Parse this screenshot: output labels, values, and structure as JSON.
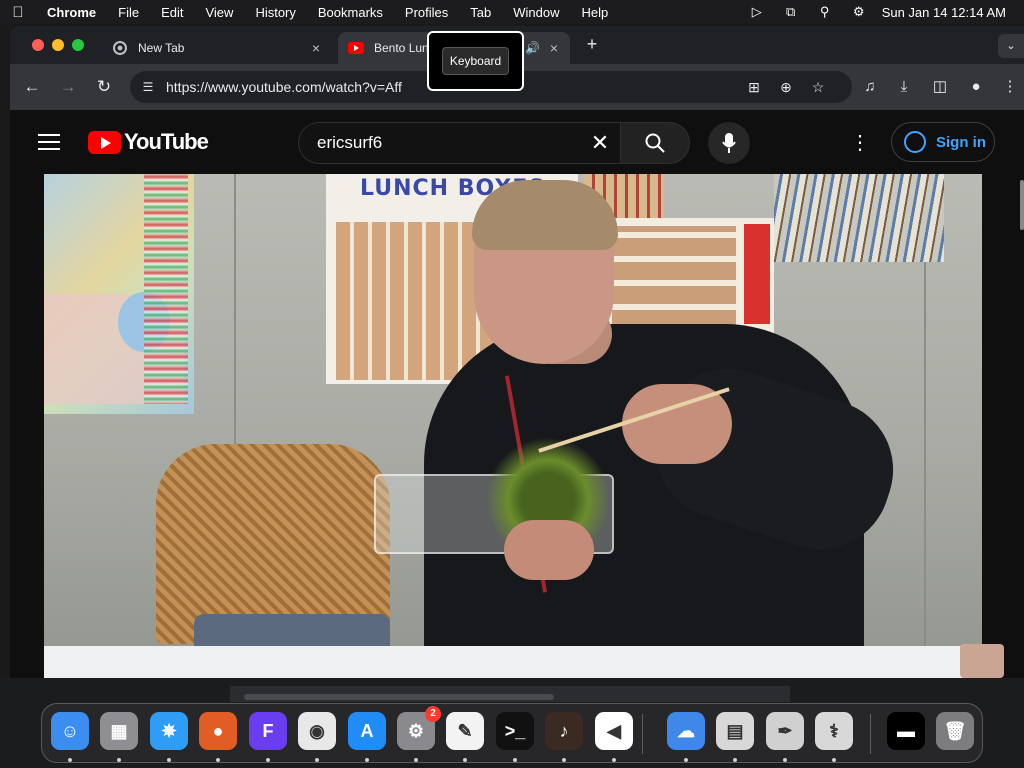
{
  "menubar": {
    "app_name": "Chrome",
    "items": [
      "File",
      "Edit",
      "View",
      "History",
      "Bookmarks",
      "Profiles",
      "Tab",
      "Window",
      "Help"
    ],
    "clock": "Sun Jan 14  12:14 AM"
  },
  "browser": {
    "tabs": [
      {
        "title": "New Tab",
        "close": "×"
      },
      {
        "title": "Bento Lunch",
        "close": "×"
      }
    ],
    "new_tab_symbol": "+",
    "tab_search_symbol": "⌄",
    "url": "https://www.youtube.com/watch?v=Aff",
    "tooltip": "Keyboard"
  },
  "youtube": {
    "logo_text": "YouTube",
    "search_query": "ericsurf6",
    "search_clear": "✕",
    "search_icon": "⌕",
    "mic_icon": "🎙",
    "more_icon": "⋮",
    "sign_in": "Sign in"
  },
  "video": {
    "poster_text": "LUNCH BOXES"
  },
  "dock": {
    "apps": [
      {
        "name": "Finder",
        "icon": "finder-icon",
        "color": "#3b8ef0",
        "glyph": "☺"
      },
      {
        "name": "Launchpad",
        "icon": "launchpad-icon",
        "color": "#8e8e93",
        "glyph": "▦"
      },
      {
        "name": "Safari",
        "icon": "safari-icon",
        "color": "#2f9cf5",
        "glyph": "✵"
      },
      {
        "name": "Firefox",
        "icon": "firefox-icon",
        "color": "#e25c25",
        "glyph": "●"
      },
      {
        "name": "Fleet",
        "icon": "fleet-icon",
        "color": "#6a3df0",
        "glyph": "F"
      },
      {
        "name": "Chrome",
        "icon": "chrome-icon",
        "color": "#e8e8e8",
        "glyph": "◉"
      },
      {
        "name": "App Store",
        "icon": "appstore-icon",
        "color": "#1f8cf8",
        "glyph": "A"
      },
      {
        "name": "System Settings",
        "icon": "settings-icon",
        "color": "#8a8a8e",
        "glyph": "⚙",
        "badge": "2"
      },
      {
        "name": "TextEdit",
        "icon": "textedit-icon",
        "color": "#f3f3f3",
        "glyph": "✎"
      },
      {
        "name": "Terminal",
        "icon": "terminal-icon",
        "color": "#111111",
        "glyph": ">_"
      },
      {
        "name": "GarageBand",
        "icon": "garageband-icon",
        "color": "#3b2a22",
        "glyph": "♪"
      },
      {
        "name": "Visual Studio Code",
        "icon": "vscode-icon",
        "color": "#ffffff",
        "glyph": "◀"
      },
      {
        "name": "Weather",
        "icon": "weather-icon",
        "color": "#3f87e8",
        "glyph": "☁"
      },
      {
        "name": "Preview",
        "icon": "preview-icon",
        "color": "#d8d8d8",
        "glyph": "▤"
      },
      {
        "name": "Script Editor",
        "icon": "scripteditor-icon",
        "color": "#d0d0d0",
        "glyph": "✒"
      },
      {
        "name": "Disk Utility",
        "icon": "diskutility-icon",
        "color": "#d8d8d8",
        "glyph": "⚕"
      },
      {
        "name": "Downloads",
        "icon": "downloads-stack-icon",
        "color": "#000000",
        "glyph": "▬"
      },
      {
        "name": "Trash",
        "icon": "trash-icon",
        "color": "#7d7d80",
        "glyph": "🗑"
      }
    ]
  }
}
